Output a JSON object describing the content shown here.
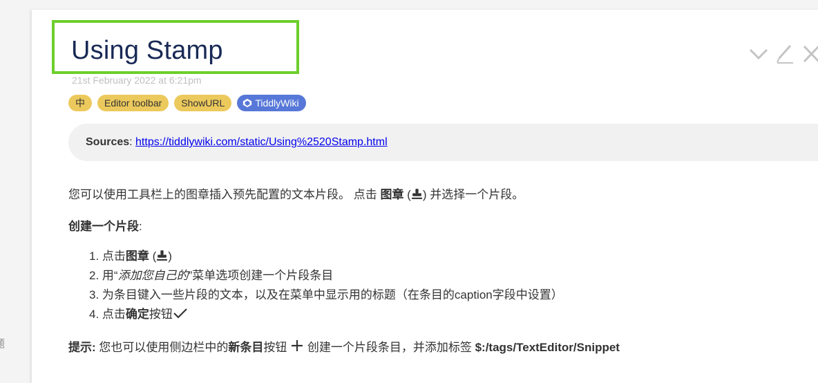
{
  "edge_text": "题",
  "tiddler": {
    "title": "Using Stamp",
    "modified": "21st February 2022 at 6:21pm",
    "tags": [
      {
        "label": "中"
      },
      {
        "label": "Editor toolbar"
      },
      {
        "label": "ShowURL"
      },
      {
        "label": "TiddlyWiki"
      }
    ],
    "colors": {
      "tag_yellow": "#ecc95c",
      "tag_blue": "#5778d8",
      "highlight": "#6ccf2b",
      "title": "#182955"
    },
    "sources": {
      "label": "Sources",
      "sep": ": ",
      "url": "https://tiddlywiki.com/static/Using%2520Stamp.html"
    },
    "intro": {
      "before": "您可以使用工具栏上的图章插入预先配置的文本片段。 点击 ",
      "bold": "图章",
      "open": " (",
      "close": ") 并选择一个片段。"
    },
    "create_heading": {
      "bold": "创建一个片段",
      "colon": ":"
    },
    "steps": [
      {
        "num": "1. ",
        "pre": "点击",
        "bold": "图章",
        "open": " (",
        "close": ")"
      },
      {
        "num": "2. ",
        "pre": "用“",
        "ital": "添加您自己的",
        "post": "”菜单选项创建一个片段条目"
      },
      {
        "num": "3. ",
        "text": "为条目键入一些片段的文本，以及在菜单中显示用的标题（在条目的caption字段中设置）"
      },
      {
        "num": "4. ",
        "pre": "点击",
        "bold": "确定",
        "post": "按钮"
      }
    ],
    "tip": {
      "label": "提示:",
      "a": " 您也可以使用侧边栏中的",
      "bold": "新条目",
      "b": "按钮 ",
      "c": " 创建一个片段条目，并添加标签 ",
      "tag": "$:/tags/TextEditor/Snippet"
    }
  }
}
